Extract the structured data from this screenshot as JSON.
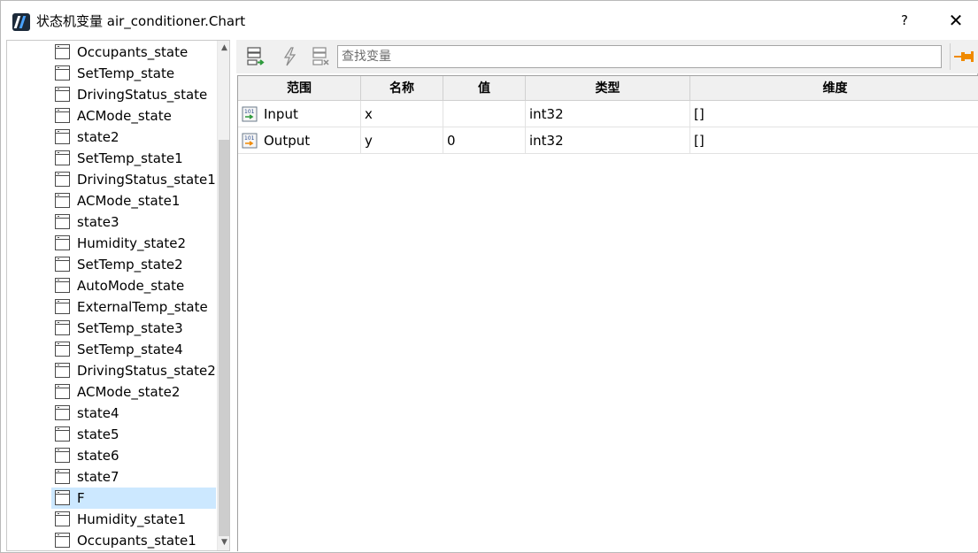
{
  "window": {
    "title": "状态机变量 air_conditioner.Chart",
    "help_label": "?",
    "close_label": "✕"
  },
  "tree": {
    "items": [
      {
        "label": "Occupants_state",
        "selected": false
      },
      {
        "label": "SetTemp_state",
        "selected": false
      },
      {
        "label": "DrivingStatus_state",
        "selected": false
      },
      {
        "label": "ACMode_state",
        "selected": false
      },
      {
        "label": "state2",
        "selected": false
      },
      {
        "label": "SetTemp_state1",
        "selected": false
      },
      {
        "label": "DrivingStatus_state1",
        "selected": false
      },
      {
        "label": "ACMode_state1",
        "selected": false
      },
      {
        "label": "state3",
        "selected": false
      },
      {
        "label": "Humidity_state2",
        "selected": false
      },
      {
        "label": "SetTemp_state2",
        "selected": false
      },
      {
        "label": "AutoMode_state",
        "selected": false
      },
      {
        "label": "ExternalTemp_state",
        "selected": false
      },
      {
        "label": "SetTemp_state3",
        "selected": false
      },
      {
        "label": "SetTemp_state4",
        "selected": false
      },
      {
        "label": "DrivingStatus_state2",
        "selected": false
      },
      {
        "label": "ACMode_state2",
        "selected": false
      },
      {
        "label": "state4",
        "selected": false
      },
      {
        "label": "state5",
        "selected": false
      },
      {
        "label": "state6",
        "selected": false
      },
      {
        "label": "state7",
        "selected": false
      },
      {
        "label": "F",
        "selected": true
      },
      {
        "label": "Humidity_state1",
        "selected": false
      },
      {
        "label": "Occupants_state1",
        "selected": false
      }
    ]
  },
  "toolbar": {
    "search_placeholder": "查找变量",
    "search_value": ""
  },
  "table": {
    "columns": [
      "范围",
      "名称",
      "值",
      "类型",
      "维度"
    ],
    "rows": [
      {
        "scope": "Input",
        "scope_icon": "input-variable-icon",
        "name": "x",
        "value": "",
        "type": "int32",
        "dim": "[]"
      },
      {
        "scope": "Output",
        "scope_icon": "output-variable-icon",
        "name": "y",
        "value": "0",
        "type": "int32",
        "dim": "[]"
      }
    ]
  },
  "colors": {
    "selection": "#cce8ff",
    "pin": "#f08a00",
    "toolbar_green": "#2e9a3c"
  }
}
